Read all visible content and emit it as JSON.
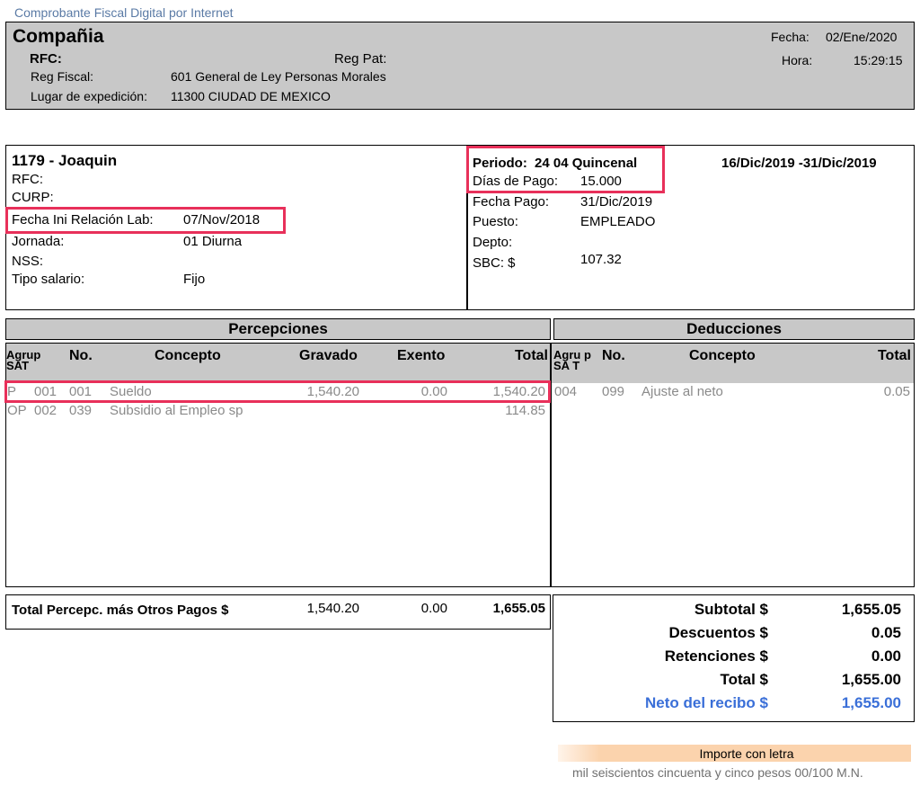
{
  "top_caption": "Comprobante Fiscal Digital por Internet",
  "company": {
    "name": "Compañia",
    "rfc_label": "RFC:",
    "regpat_label": "Reg Pat:",
    "regfiscal_label": "Reg Fiscal:",
    "regfiscal_value": "601 General de Ley Personas Morales",
    "lugar_label": "Lugar de expedición:",
    "lugar_value": "11300 CIUDAD DE MEXICO",
    "fecha_label": "Fecha:",
    "fecha_value": "02/Ene/2020",
    "hora_label": "Hora:",
    "hora_value": "15:29:15"
  },
  "employee": {
    "title": "1179 - Joaquin",
    "rfc_label": "RFC:",
    "curp_label": "CURP:",
    "fecha_ini_label": "Fecha Ini Relación Lab:",
    "fecha_ini_value": "07/Nov/2018",
    "jornada_label": "Jornada:",
    "jornada_value": "01 Diurna",
    "nss_label": "NSS:",
    "tipo_salario_label": "Tipo salario:",
    "tipo_salario_value": "Fijo"
  },
  "period": {
    "periodo_label": "Periodo:",
    "periodo_value": "24 04 Quincenal",
    "range": "16/Dic/2019 -31/Dic/2019",
    "dias_label": "Días de Pago:",
    "dias_value": "15.000",
    "fecha_pago_label": "Fecha Pago:",
    "fecha_pago_value": "31/Dic/2019",
    "puesto_label": "Puesto:",
    "puesto_value": "EMPLEADO",
    "depto_label": "Depto:",
    "sbc_label": "SBC: $",
    "sbc_value": "107.32"
  },
  "percepciones": {
    "title": "Percepciones",
    "headers": {
      "agrup": "Agrup SAT",
      "no": "No.",
      "concepto": "Concepto",
      "gravado": "Gravado",
      "exento": "Exento",
      "total": "Total"
    },
    "rows": [
      {
        "agrup": "P",
        "sat": "001",
        "no": "001",
        "concepto": "Sueldo",
        "gravado": "1,540.20",
        "exento": "0.00",
        "total": "1,540.20"
      },
      {
        "agrup": "OP",
        "sat": "002",
        "no": "039",
        "concepto": "Subsidio al Empleo sp",
        "gravado": "",
        "exento": "",
        "total": "114.85"
      }
    ]
  },
  "deducciones": {
    "title": "Deducciones",
    "headers": {
      "agrup": "Agru p SA T",
      "no": "No.",
      "concepto": "Concepto",
      "total": "Total"
    },
    "rows": [
      {
        "agrup": "004",
        "no": "099",
        "concepto": "Ajuste al neto",
        "total": "0.05"
      }
    ]
  },
  "totals_left": {
    "label": "Total Percepc. más Otros Pagos  $",
    "gravado": "1,540.20",
    "exento": "0.00",
    "total": "1,655.05"
  },
  "totals_right": {
    "subtotal_label": "Subtotal $",
    "subtotal_value": "1,655.05",
    "descuentos_label": "Descuentos $",
    "descuentos_value": "0.05",
    "retenciones_label": "Retenciones $",
    "retenciones_value": "0.00",
    "total_label": "Total $",
    "total_value": "1,655.00",
    "neto_label": "Neto del recibo $",
    "neto_value": "1,655.00"
  },
  "importe": {
    "label": "Importe con letra",
    "text": "mil seiscientos cincuenta y cinco pesos 00/100 M.N."
  },
  "colors": {
    "highlight": "#e8305a",
    "neto": "#3a6fd8",
    "header_bg": "#c8c8c8",
    "importe_bg": "#fbd3ad"
  }
}
